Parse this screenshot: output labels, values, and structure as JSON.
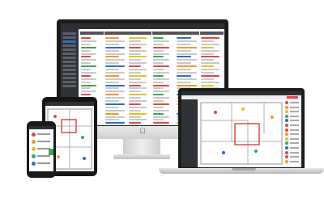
{
  "scene": {
    "description_free": true,
    "colors": {
      "accent": "#2b6fc4",
      "red": "#e04848",
      "green": "#3aa757",
      "orange": "#f2992e",
      "yellow": "#e6c229",
      "dark": "#2d2f33"
    },
    "icons": [
      "apple-logo-icon"
    ]
  }
}
